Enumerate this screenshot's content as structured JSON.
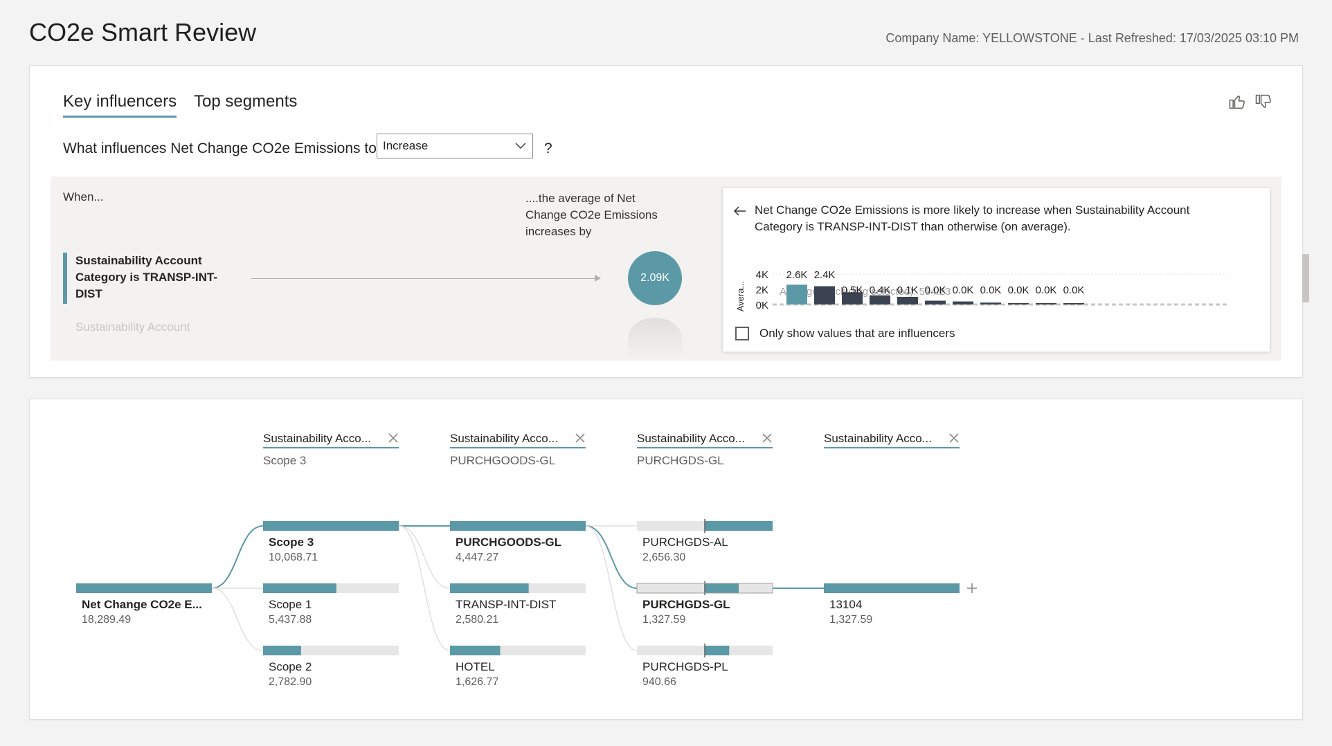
{
  "page": {
    "title": "CO2e Smart Review",
    "meta": "Company Name: YELLOWSTONE - Last Refreshed: 17/03/2025 03:10 PM"
  },
  "key_influencers": {
    "tabs": [
      "Key influencers",
      "Top segments"
    ],
    "question": "What influences Net Change CO2e Emissions to",
    "dropdown_value": "Increase",
    "qmark": "?",
    "when_label": "When...",
    "avg_label": "....the average of Net Change CO2e Emissions increases by",
    "influencers": [
      {
        "label": "Sustainability Account Category is TRANSP-INT-DIST",
        "value": "2.09K"
      },
      {
        "label": "Sustainability Account"
      }
    ],
    "detail": {
      "text": "Net Change CO2e Emissions is more likely to increase when Sustainability Account Category is TRANSP-INT-DIST than otherwise (on average).",
      "checkbox_label": "Only show values that are influencers",
      "chart": {
        "y_axis_label": "Avera...",
        "y_ticks": [
          "4K",
          "2K",
          "0K"
        ],
        "average_line_label": "Average (excluding selected): 554.23",
        "bar_labels": [
          "2.6K",
          "2.4K",
          "0.5K",
          "0.4K",
          "0.1K",
          "0.0K",
          "0.0K",
          "0.0K",
          "0.0K",
          "0.0K",
          "0.0K"
        ],
        "values": [
          2600,
          2400,
          1600,
          1200,
          1000,
          500,
          400,
          250,
          50,
          20,
          10
        ]
      }
    }
  },
  "decomposition": {
    "levels": [
      {
        "header": "Sustainability Acco...",
        "sub": "Scope 3"
      },
      {
        "header": "Sustainability Acco...",
        "sub": "PURCHGOODS-GL"
      },
      {
        "header": "Sustainability Acco...",
        "sub": "PURCHGDS-GL"
      },
      {
        "header": "Sustainability Acco...",
        "sub": ""
      }
    ],
    "root": {
      "label": "Net Change CO2e E...",
      "value": "18,289.49"
    },
    "columns": [
      [
        {
          "label": "Scope 3",
          "value": "10,068.71",
          "fill": 1.0,
          "selected": true
        },
        {
          "label": "Scope 1",
          "value": "5,437.88",
          "fill": 0.54
        },
        {
          "label": "Scope 2",
          "value": "2,782.90",
          "fill": 0.28
        }
      ],
      [
        {
          "label": "PURCHGOODS-GL",
          "value": "4,447.27",
          "fill": 1.0,
          "selected": true
        },
        {
          "label": "TRANSP-INT-DIST",
          "value": "2,580.21",
          "fill": 0.58
        },
        {
          "label": "HOTEL",
          "value": "1,626.77",
          "fill": 0.37
        }
      ],
      [
        {
          "label": "PURCHGDS-AL",
          "value": "2,656.30",
          "fill_from": 0.5,
          "fill": 1.0
        },
        {
          "label": "PURCHGDS-GL",
          "value": "1,327.59",
          "fill_from": 0.5,
          "fill": 0.75,
          "selected": true
        },
        {
          "label": "PURCHGDS-PL",
          "value": "940.66",
          "fill_from": 0.5,
          "fill": 0.68
        }
      ],
      [
        {
          "label": "13104",
          "value": "1,327.59",
          "fill": 1.0
        }
      ]
    ],
    "colors": {
      "bar": "#5b99a6",
      "track": "#e6e6e6",
      "link": "#5b99a6",
      "link_faint": "#e1dfdd"
    }
  }
}
